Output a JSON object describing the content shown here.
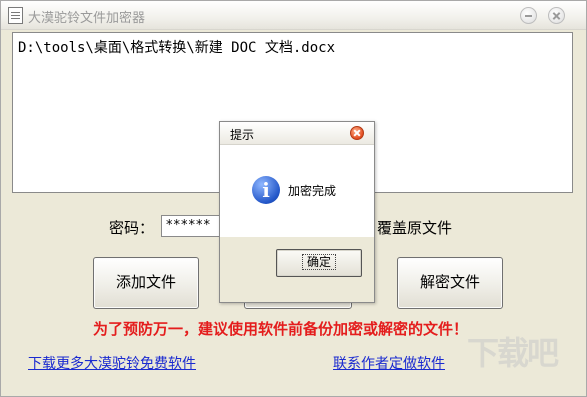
{
  "window": {
    "title": "大漠驼铃文件加密器"
  },
  "file_list": {
    "path": "D:\\tools\\桌面\\格式转换\\新建 DOC 文档.docx"
  },
  "password": {
    "label": "密码：",
    "value": "******"
  },
  "overwrite": {
    "label": "覆盖原文件"
  },
  "buttons": {
    "add_file": "添加文件",
    "decrypt_file": "解密文件"
  },
  "warning_text": "为了预防万一，建议使用软件前备份加密或解密的文件！",
  "links": {
    "download_more": "下载更多大漠驼铃免费软件",
    "contact_author": "联系作者定做软件"
  },
  "dialog": {
    "title": "提示",
    "message": "加密完成",
    "ok_label": "确定",
    "icon": "info-icon"
  },
  "watermark": "下载吧"
}
